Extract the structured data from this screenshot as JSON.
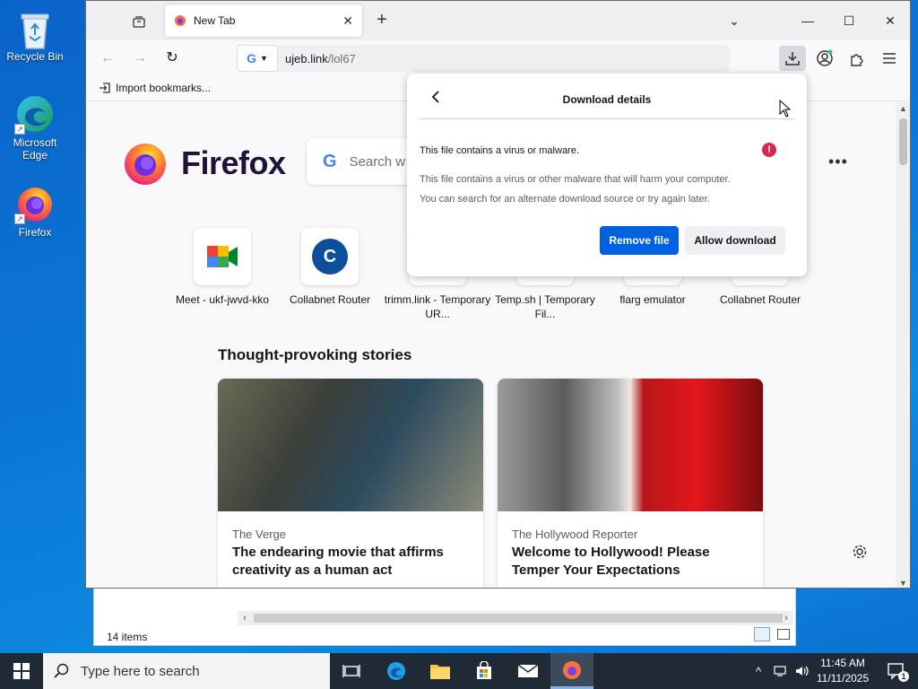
{
  "desktop": {
    "icons": [
      {
        "label": "Recycle Bin"
      },
      {
        "label": "Microsoft Edge"
      },
      {
        "label": "Firefox"
      }
    ]
  },
  "explorer": {
    "status": "14 items"
  },
  "browser": {
    "tab": {
      "title": "New Tab"
    },
    "url": {
      "domain": "ujeb.link",
      "path": "/lol67"
    },
    "bookmarks": {
      "import_label": "Import bookmarks..."
    },
    "newtab": {
      "brand": "Firefox",
      "search_placeholder": "Search w",
      "shortcuts": [
        {
          "label": "Meet - ukf-jwvd-kko",
          "letter": ""
        },
        {
          "label": "Collabnet Router",
          "letter": "C"
        },
        {
          "label": "trimm.link - Temporary UR...",
          "letter": ""
        },
        {
          "label": "Temp.sh | Temporary Fil...",
          "letter": ""
        },
        {
          "label": "flarg emulator",
          "letter": ""
        },
        {
          "label": "Collabnet Router",
          "letter": ""
        }
      ],
      "stories_heading": "Thought-provoking stories",
      "stories": [
        {
          "source": "The Verge",
          "title": "The endearing movie that affirms creativity as a human act"
        },
        {
          "source": "The Hollywood Reporter",
          "title": "Welcome to Hollywood! Please Temper Your Expectations"
        }
      ]
    }
  },
  "download_panel": {
    "title": "Download details",
    "warning": "This file contains a virus or malware.",
    "badge": "!",
    "desc1": "This file contains a virus or other malware that will harm your computer.",
    "desc2": "You can search for an alternate download source or try again later.",
    "remove_label": "Remove file",
    "allow_label": "Allow download"
  },
  "taskbar": {
    "search_placeholder": "Type here to search",
    "time": "11:45 AM",
    "date": "11/11/2025",
    "notification_count": "1"
  },
  "colors": {
    "accent": "#0061e0",
    "danger": "#d7264c",
    "taskbar": "#1f2a36"
  }
}
